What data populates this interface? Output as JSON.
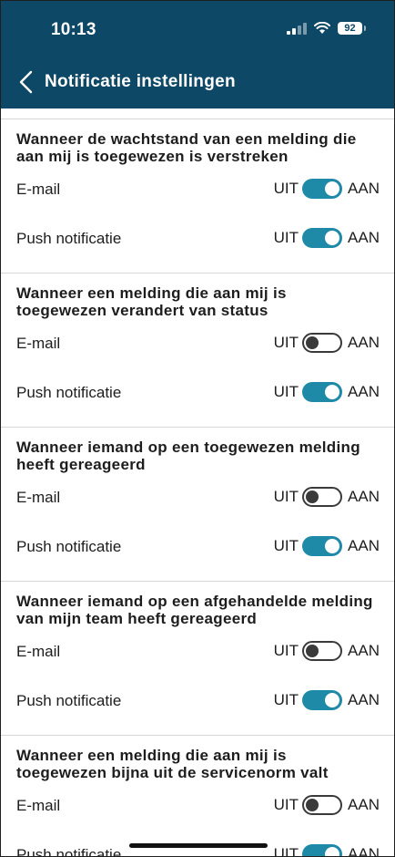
{
  "status_bar": {
    "time": "10:13",
    "battery": "92"
  },
  "header": {
    "title": "Notificatie instellingen"
  },
  "toggle_labels": {
    "off": "UIT",
    "on": "AAN"
  },
  "sections": [
    {
      "title": "Wanneer de wachtstand van een melding die aan mij is toegewezen is verstreken",
      "rows": [
        {
          "label": "E-mail",
          "enabled": true
        },
        {
          "label": "Push notificatie",
          "enabled": true
        }
      ]
    },
    {
      "title": "Wanneer een melding die aan mij is toegewezen verandert van status",
      "rows": [
        {
          "label": "E-mail",
          "enabled": false
        },
        {
          "label": "Push notificatie",
          "enabled": true
        }
      ]
    },
    {
      "title": "Wanneer iemand op een toegewezen melding heeft gereageerd",
      "rows": [
        {
          "label": "E-mail",
          "enabled": false
        },
        {
          "label": "Push notificatie",
          "enabled": true
        }
      ]
    },
    {
      "title": "Wanneer iemand op een afgehandelde melding van mijn team heeft gereageerd",
      "rows": [
        {
          "label": "E-mail",
          "enabled": false
        },
        {
          "label": "Push notificatie",
          "enabled": true
        }
      ]
    },
    {
      "title": "Wanneer een melding die aan mij is toegewezen bijna uit de servicenorm valt",
      "rows": [
        {
          "label": "E-mail",
          "enabled": false
        },
        {
          "label": "Push notificatie",
          "enabled": true
        }
      ]
    }
  ],
  "colors": {
    "header_bg": "#0d4866",
    "toggle_on": "#1f8aa8",
    "toggle_off_border": "#3a3a3a"
  }
}
